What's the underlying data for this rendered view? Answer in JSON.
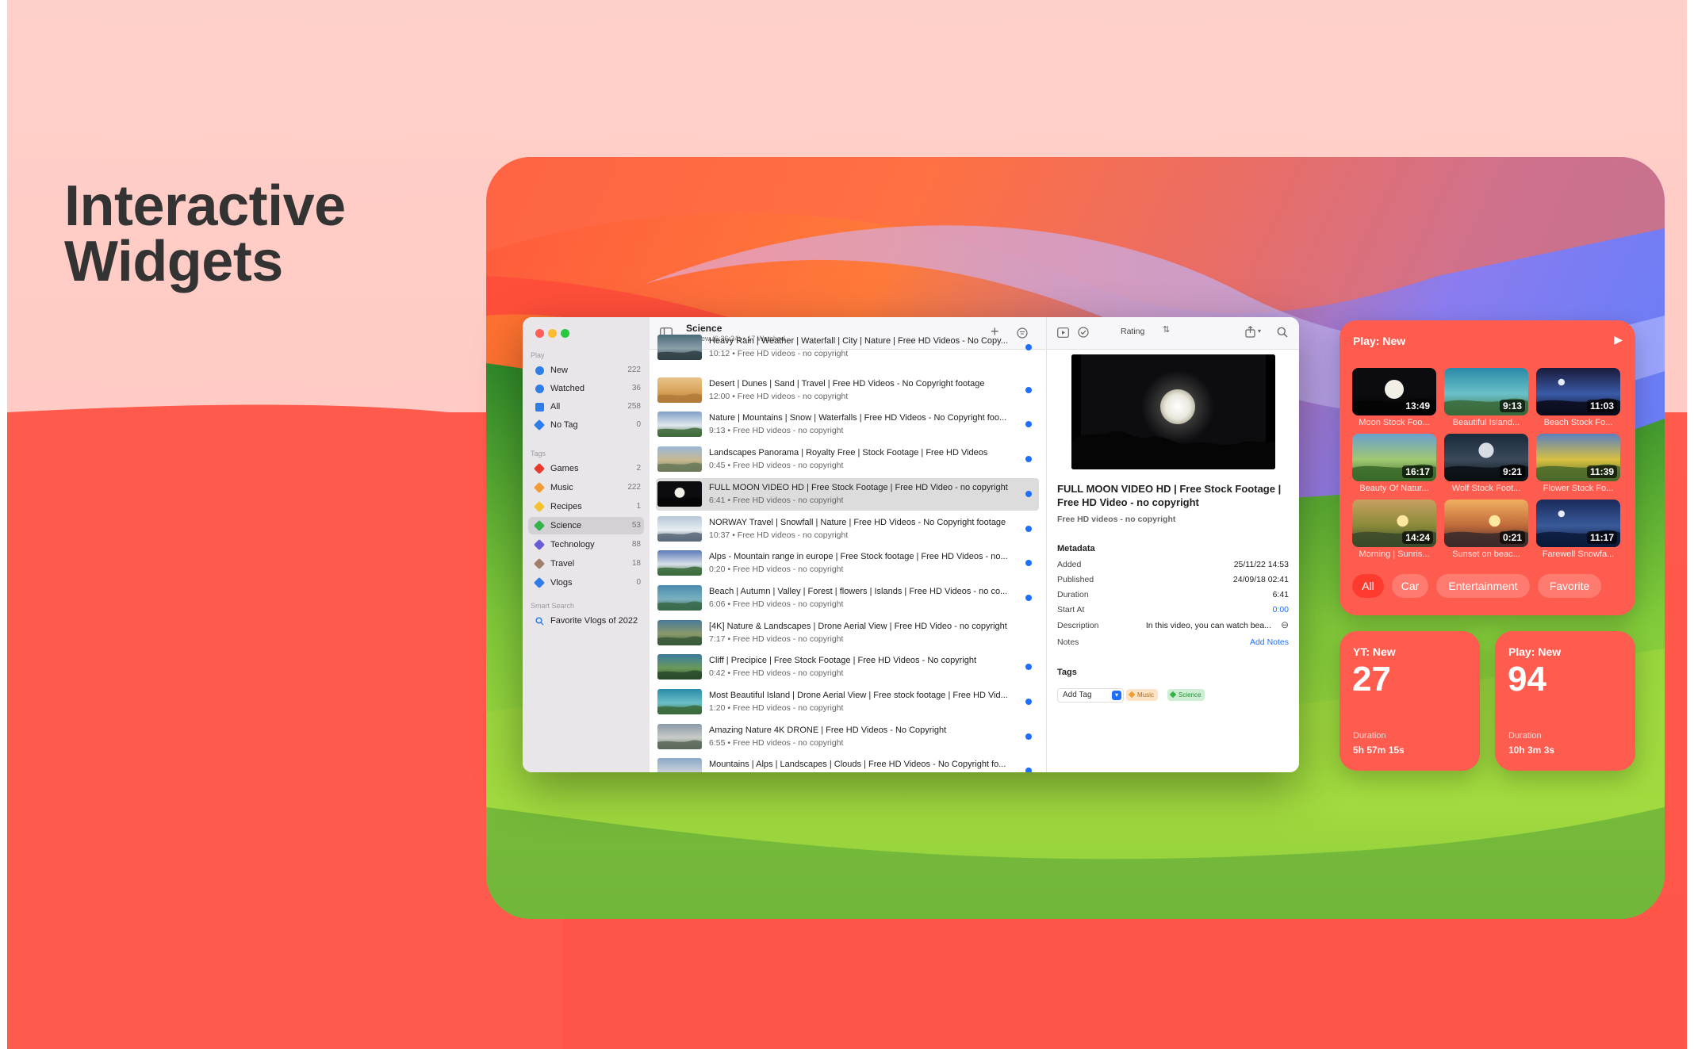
{
  "headline": {
    "line1": "Interactive",
    "line2": "Widgets"
  },
  "window": {
    "sidebar": {
      "section_play": "Play",
      "play_items": [
        {
          "label": "New",
          "count": "222"
        },
        {
          "label": "Watched",
          "count": "36"
        },
        {
          "label": "All",
          "count": "258"
        },
        {
          "label": "No Tag",
          "count": "0"
        }
      ],
      "section_tags": "Tags",
      "tag_items": [
        {
          "label": "Games",
          "count": "2",
          "color": "#e8392f"
        },
        {
          "label": "Music",
          "count": "222",
          "color": "#f29a33"
        },
        {
          "label": "Recipes",
          "count": "1",
          "color": "#f2c230"
        },
        {
          "label": "Science",
          "count": "53",
          "color": "#34b34a"
        },
        {
          "label": "Technology",
          "count": "88",
          "color": "#6a5cd6"
        },
        {
          "label": "Travel",
          "count": "18",
          "color": "#a0806a"
        },
        {
          "label": "Vlogs",
          "count": "0",
          "color": "#2f7de8"
        }
      ],
      "section_smart": "Smart Search",
      "smart_items": [
        {
          "label": "Favorite Vlogs of 2022"
        }
      ]
    },
    "list": {
      "title": "Science",
      "subtitle": "53 New (6:36:24) • 17 Watched",
      "rows": [
        {
          "title": "Heavy Rain | Weather | Waterfall | City | Nature | Free HD Videos - No Copy...",
          "sub": "10:12 • Free HD videos - no copyright",
          "thumb": "rain"
        },
        {
          "title": "Desert | Dunes | Sand | Travel | Free HD Videos - No Copyright footage",
          "sub": "12:00 • Free HD videos - no copyright",
          "thumb": "desert"
        },
        {
          "title": "Nature | Mountains | Snow | Waterfalls | Free HD Videos - No Copyright foo...",
          "sub": "9:13 • Free HD videos - no copyright",
          "thumb": "mount"
        },
        {
          "title": "Landscapes Panorama | Royalty Free | Stock Footage | Free HD Videos",
          "sub": "0:45 • Free HD videos - no copyright",
          "thumb": "pano"
        },
        {
          "title": "FULL MOON VIDEO HD | Free Stock Footage | Free HD Video - no copyright",
          "sub": "6:41 • Free HD videos - no copyright",
          "thumb": "moon"
        },
        {
          "title": "NORWAY Travel | Snowfall | Nature | Free HD Videos - No Copyright footage",
          "sub": "10:37 • Free HD videos - no copyright",
          "thumb": "norway"
        },
        {
          "title": "Alps - Mountain range in europe | Free Stock footage | Free HD Videos - no...",
          "sub": "0:20 • Free HD videos - no copyright",
          "thumb": "alps"
        },
        {
          "title": "Beach | Autumn | Valley | Forest | flowers | Islands | Free HD Videos - no co...",
          "sub": "6:06 • Free HD videos - no copyright",
          "thumb": "beach"
        },
        {
          "title": "[4K] Nature & Landscapes | Drone Aerial View | Free HD Video - no copyright",
          "sub": "7:17 • Free HD videos - no copyright",
          "thumb": "k4"
        },
        {
          "title": "Cliff | Precipice | Free Stock Footage | Free HD Videos - No copyright",
          "sub": "0:42 • Free HD videos - no copyright",
          "thumb": "cliff"
        },
        {
          "title": "Most Beautiful Island | Drone Aerial View | Free stock footage | Free HD Vid...",
          "sub": "1:20 • Free HD videos - no copyright",
          "thumb": "island"
        },
        {
          "title": "Amazing Nature 4K DRONE | Free HD Videos - No Copyright",
          "sub": "6:55 • Free HD videos - no copyright",
          "thumb": "drone"
        },
        {
          "title": "Mountains | Alps | Landscapes | Clouds | Free HD Videos - No Copyright fo...",
          "sub": "",
          "thumb": "mount2"
        }
      ]
    },
    "detail": {
      "sort_label": "Rating",
      "title": "FULL MOON VIDEO HD | Free Stock Footage | Free HD Video - no copyright",
      "channel": "Free HD videos - no copyright",
      "metadata_header": "Metadata",
      "meta": [
        {
          "key": "Added",
          "value": "25/11/22 14:53"
        },
        {
          "key": "Published",
          "value": "24/09/18 02:41"
        },
        {
          "key": "Duration",
          "value": "6:41"
        },
        {
          "key": "Start At",
          "value": "0:00"
        },
        {
          "key": "Description",
          "value": "In this video, you can watch bea..."
        },
        {
          "key": "Notes",
          "value": "Add Notes"
        }
      ],
      "tags_header": "Tags",
      "add_tag": "Add Tag",
      "tags": [
        {
          "label": "Music",
          "color": "#f29a33"
        },
        {
          "label": "Science",
          "color": "#34b34a"
        }
      ]
    }
  },
  "widget_large": {
    "title": "Play: New",
    "tiles": [
      {
        "dur": "13:49",
        "caption": "Moon Stock Foo...",
        "thumb": "moon"
      },
      {
        "dur": "9:13",
        "caption": "Beautiful Island...",
        "thumb": "island"
      },
      {
        "dur": "11:03",
        "caption": "Beach Stock Fo...",
        "thumb": "beachn"
      },
      {
        "dur": "16:17",
        "caption": "Beauty Of Natur...",
        "thumb": "fall"
      },
      {
        "dur": "9:21",
        "caption": "Wolf Stock Foot...",
        "thumb": "wolf"
      },
      {
        "dur": "11:39",
        "caption": "Flower Stock Fo...",
        "thumb": "flower"
      },
      {
        "dur": "14:24",
        "caption": "Morning | Sunris...",
        "thumb": "morning"
      },
      {
        "dur": "0:21",
        "caption": "Sunset on beac...",
        "thumb": "sunset"
      },
      {
        "dur": "11:17",
        "caption": "Farewell Snowfa...",
        "thumb": "snow"
      }
    ],
    "chips": [
      "All",
      "Car",
      "Entertainment",
      "Favorite"
    ],
    "active_chip": "All"
  },
  "widget_small_1": {
    "title": "YT: New",
    "value": "27",
    "label": "Duration",
    "duration": "5h 57m 15s"
  },
  "widget_small_2": {
    "title": "Play: New",
    "value": "94",
    "label": "Duration",
    "duration": "10h 3m 3s"
  }
}
